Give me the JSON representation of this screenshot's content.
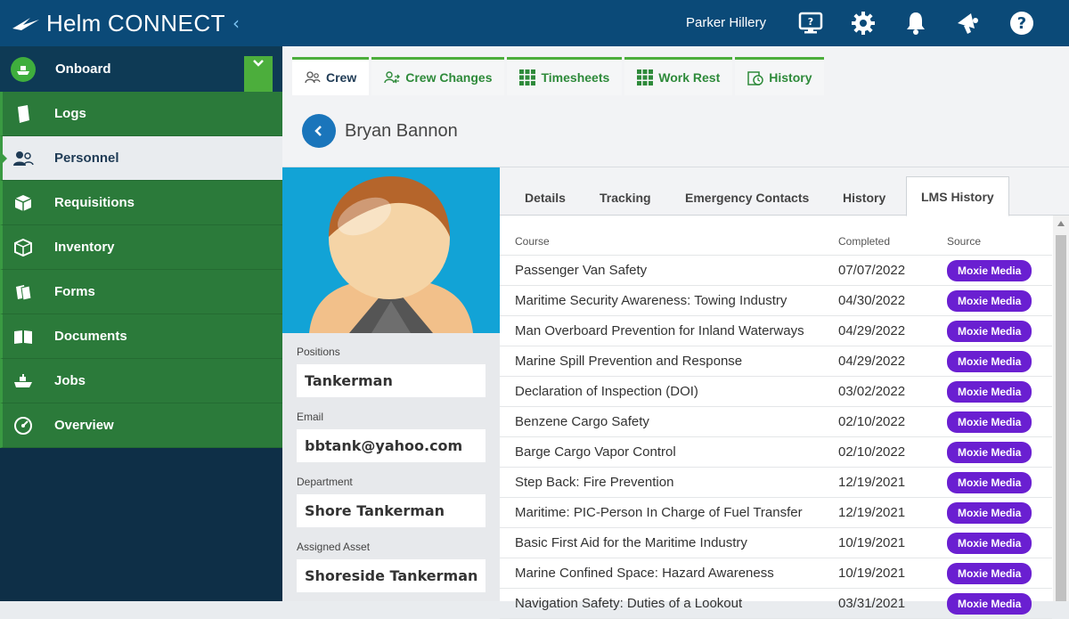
{
  "app": {
    "brand_light": "Helm",
    "brand_bold": "CONNECT",
    "brand_chev": "‹"
  },
  "header": {
    "user_name": "Parker Hillery"
  },
  "sidebar": {
    "section": "Onboard",
    "items": [
      {
        "label": "Logs",
        "icon": "logbook-icon"
      },
      {
        "label": "Personnel",
        "icon": "people-icon"
      },
      {
        "label": "Requisitions",
        "icon": "package-icon"
      },
      {
        "label": "Inventory",
        "icon": "box-icon"
      },
      {
        "label": "Forms",
        "icon": "forms-icon"
      },
      {
        "label": "Documents",
        "icon": "book-icon"
      },
      {
        "label": "Jobs",
        "icon": "ship-icon"
      },
      {
        "label": "Overview",
        "icon": "gauge-icon"
      }
    ]
  },
  "tabs": [
    {
      "label": "Crew"
    },
    {
      "label": "Crew Changes"
    },
    {
      "label": "Timesheets"
    },
    {
      "label": "Work Rest"
    },
    {
      "label": "History"
    }
  ],
  "person": {
    "name": "Bryan Bannon"
  },
  "fields": {
    "positions_label": "Positions",
    "positions_value": "Tankerman",
    "email_label": "Email",
    "email_value": "bbtank@yahoo.com",
    "department_label": "Department",
    "department_value": "Shore Tankerman",
    "asset_label": "Assigned Asset",
    "asset_value": "Shoreside Tankerman"
  },
  "subtabs": [
    "Details",
    "Tracking",
    "Emergency Contacts",
    "History",
    "LMS History"
  ],
  "table": {
    "headers": [
      "Course",
      "Completed",
      "Source"
    ],
    "rows": [
      {
        "course": "Passenger Van Safety",
        "date": "07/07/2022",
        "source": "Moxie Media"
      },
      {
        "course": "Maritime Security Awareness: Towing Industry",
        "date": "04/30/2022",
        "source": "Moxie Media"
      },
      {
        "course": "Man Overboard Prevention for Inland Waterways",
        "date": "04/29/2022",
        "source": "Moxie Media"
      },
      {
        "course": "Marine Spill Prevention and Response",
        "date": "04/29/2022",
        "source": "Moxie Media"
      },
      {
        "course": "Declaration of Inspection (DOI)",
        "date": "03/02/2022",
        "source": "Moxie Media"
      },
      {
        "course": "Benzene Cargo Safety",
        "date": "02/10/2022",
        "source": "Moxie Media"
      },
      {
        "course": "Barge Cargo Vapor Control",
        "date": "02/10/2022",
        "source": "Moxie Media"
      },
      {
        "course": "Step Back: Fire Prevention",
        "date": "12/19/2021",
        "source": "Moxie Media"
      },
      {
        "course": "Maritime: PIC-Person In Charge of Fuel Transfer",
        "date": "12/19/2021",
        "source": "Moxie Media"
      },
      {
        "course": "Basic First Aid for the Maritime Industry",
        "date": "10/19/2021",
        "source": "Moxie Media"
      },
      {
        "course": "Marine Confined Space: Hazard Awareness",
        "date": "10/19/2021",
        "source": "Moxie Media"
      },
      {
        "course": "Navigation Safety: Duties of a Lookout",
        "date": "03/31/2021",
        "source": "Moxie Media"
      }
    ]
  },
  "colors": {
    "topbar": "#0b4a78",
    "nav_green": "#2b7a3a",
    "accent_green": "#4cae3c",
    "badge": "#6a1fd1",
    "back_btn": "#1a75bb"
  }
}
